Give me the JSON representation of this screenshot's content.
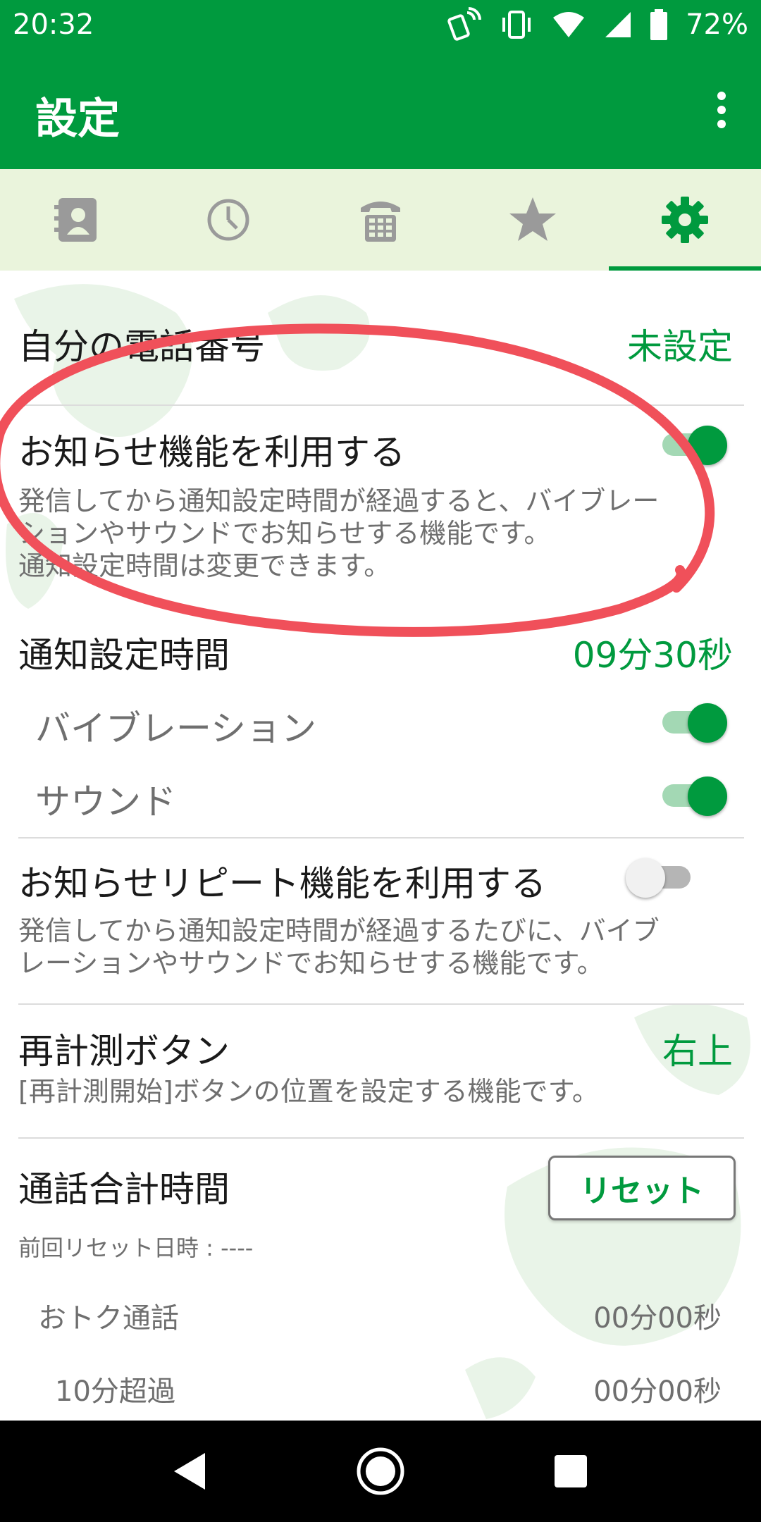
{
  "status_bar": {
    "time": "20:32",
    "battery": "72%"
  },
  "app_bar": {
    "title": "設定"
  },
  "tabs": [
    {
      "icon": "contacts-icon"
    },
    {
      "icon": "history-icon"
    },
    {
      "icon": "dialpad-icon"
    },
    {
      "icon": "star-icon"
    },
    {
      "icon": "gear-icon",
      "active": true
    }
  ],
  "settings": {
    "my_number": {
      "label": "自分の電話番号",
      "value": "未設定"
    },
    "notify": {
      "label": "お知らせ機能を利用する",
      "enabled": true,
      "description_lines": [
        "発信してから通知設定時間が経過すると、バイブレー",
        "ションやサウンドでお知らせする機能です。",
        "通知設定時間は変更できます。"
      ]
    },
    "notify_time": {
      "label": "通知設定時間",
      "value": "09分30秒"
    },
    "vibration": {
      "label": "バイブレーション",
      "enabled": true
    },
    "sound": {
      "label": "サウンド",
      "enabled": true
    },
    "repeat": {
      "label": "お知らせリピート機能を利用する",
      "enabled": false,
      "description_lines": [
        "発信してから通知設定時間が経過するたびに、バイブ",
        "レーションやサウンドでお知らせする機能です。"
      ]
    },
    "remeasure": {
      "label": "再計測ボタン",
      "value": "右上",
      "description": "[再計測開始]ボタンの位置を設定する機能です。"
    },
    "total_time": {
      "label": "通話合計時間",
      "reset_label": "リセット",
      "last_reset": "前回リセット日時 : ----",
      "rows": [
        {
          "label": "おトク通話",
          "value": "00分00秒"
        },
        {
          "label": "10分超過",
          "value": "00分00秒"
        }
      ]
    }
  },
  "colors": {
    "brand_green": "#009a3e",
    "tab_bg": "#eaf4dc",
    "annotation_red": "#f0505a"
  }
}
